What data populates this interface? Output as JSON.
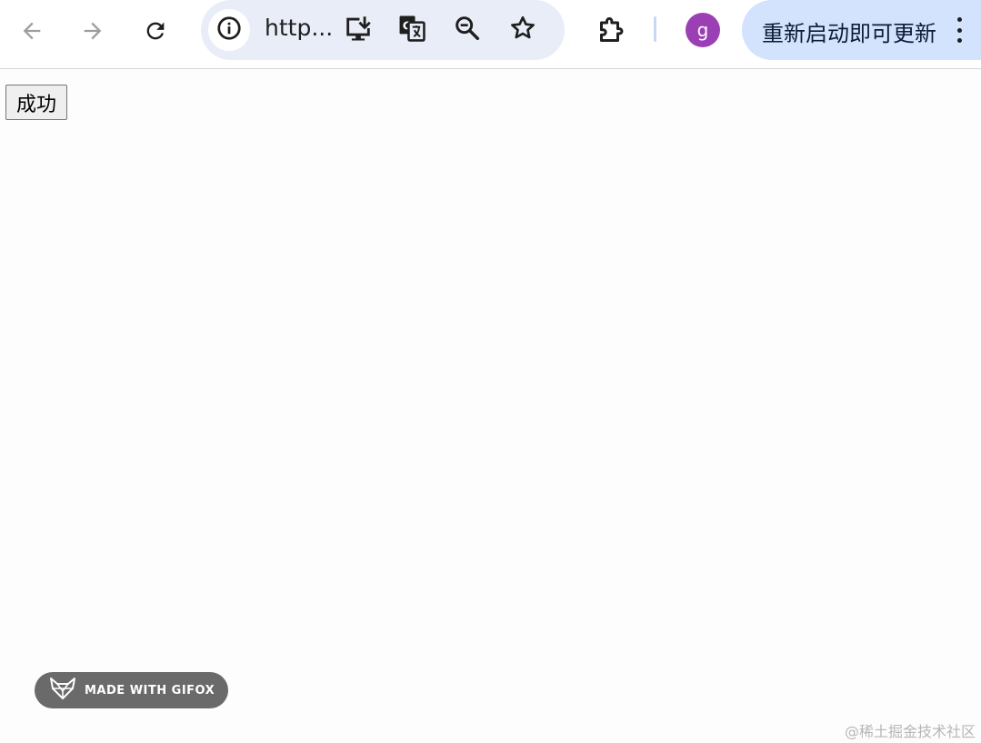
{
  "browser": {
    "nav": {
      "back_icon": "arrow-left-icon",
      "forward_icon": "arrow-right-icon",
      "reload_icon": "reload-icon"
    },
    "omnibox": {
      "site_info_icon": "info-icon",
      "url_text": "http...",
      "install_icon": "install-app-icon",
      "translate_icon": "translate-icon",
      "zoom_icon": "zoom-out-icon",
      "bookmark_icon": "star-icon"
    },
    "extensions_icon": "puzzle-icon",
    "profile": {
      "initial": "g",
      "color": "#9b3fb5"
    },
    "update_button": {
      "label": "重新启动即可更新",
      "color": "#d3e3fd"
    },
    "menu_icon": "kebab-menu-icon"
  },
  "page": {
    "button_label": "成功"
  },
  "overlays": {
    "gifox_badge": "MADE WITH GIFOX",
    "watermark": "@稀土掘金技术社区"
  }
}
